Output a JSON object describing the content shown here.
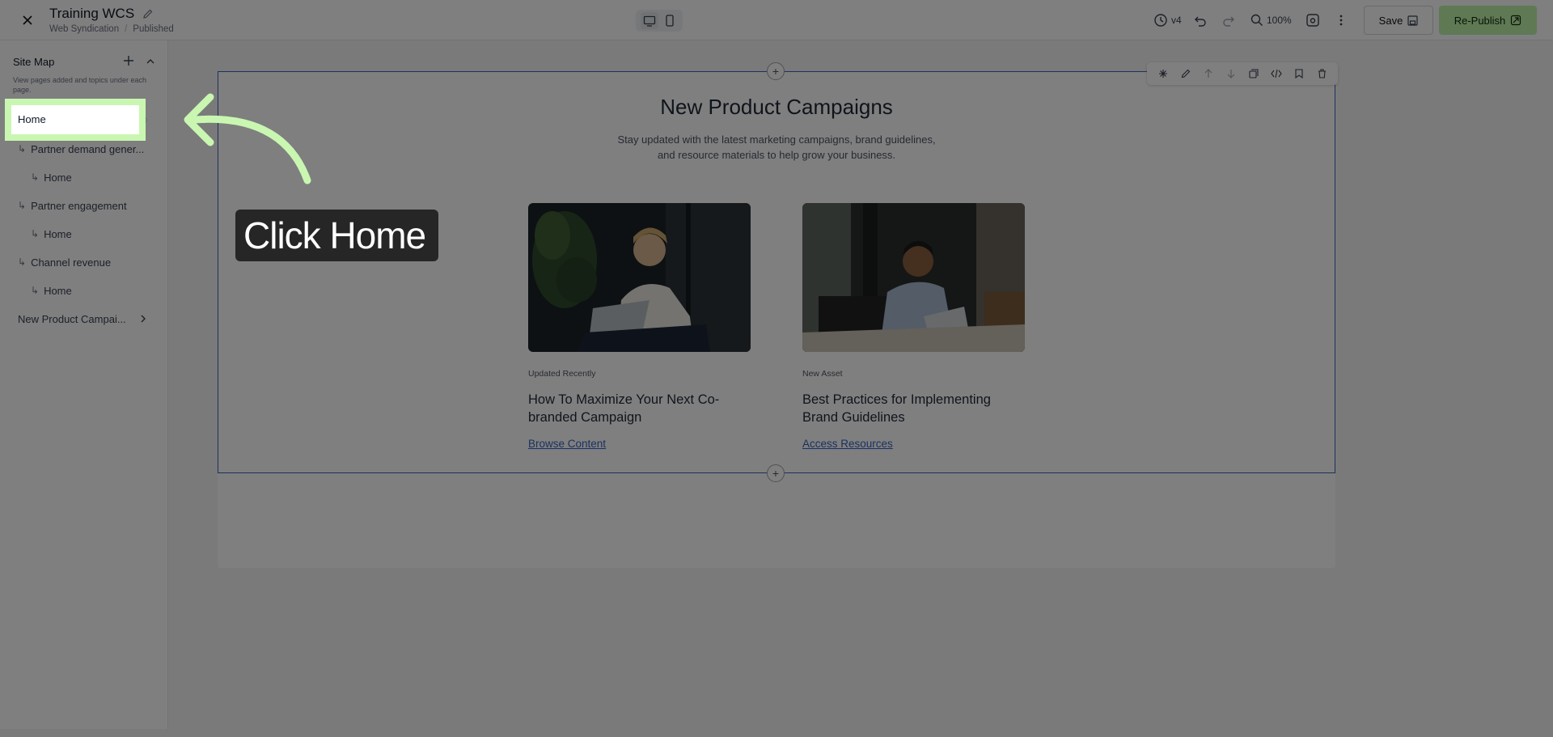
{
  "header": {
    "title": "Training WCS",
    "breadcrumb": [
      "Web Syndication",
      "Published"
    ],
    "version": "v4",
    "zoom": "100%",
    "save_label": "Save",
    "publish_label": "Re-Publish"
  },
  "sidebar": {
    "title": "Site Map",
    "description": "View pages added and topics under each page.",
    "items": [
      {
        "label": "Home",
        "level": 0
      },
      {
        "label": "Partner demand gener...",
        "level": 1
      },
      {
        "label": "Home",
        "level": 2
      },
      {
        "label": "Partner engagement",
        "level": 1
      },
      {
        "label": "Home",
        "level": 2
      },
      {
        "label": "Channel revenue",
        "level": 1
      },
      {
        "label": "Home",
        "level": 2
      },
      {
        "label": "New Product Campai...",
        "level": 0
      }
    ]
  },
  "section": {
    "title": "New Product Campaigns",
    "subtitle": "Stay updated with the latest marketing campaigns, brand guidelines, and resource materials to help grow your business.",
    "cards": [
      {
        "tag": "Updated Recently",
        "title": "How To Maximize Your Next Co-branded Campaign",
        "link": "Browse Content"
      },
      {
        "tag": "New Asset",
        "title": "Best Practices for Implementing Brand Guidelines",
        "link": "Access Resources"
      }
    ]
  },
  "overlay": {
    "callout": "Click Home",
    "highlight_color": "#c9f7b1"
  },
  "colors": {
    "accent_link": "#3563c4",
    "publish_bg": "#bff3a8",
    "section_border": "#3b63b8"
  }
}
